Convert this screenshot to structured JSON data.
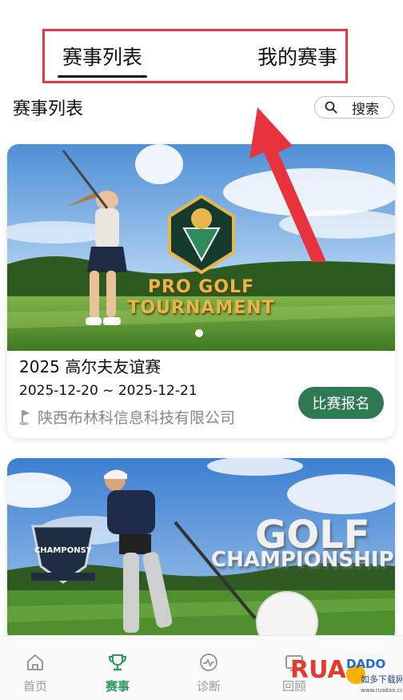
{
  "tabs": [
    {
      "label": "赛事列表",
      "active": true
    },
    {
      "label": "我的赛事",
      "active": false
    }
  ],
  "section": {
    "title": "赛事列表",
    "search_label": "搜索"
  },
  "events": [
    {
      "banner_line1": "PRO GOLF",
      "banner_line2": "TOURNAMENT",
      "name": "2025 高尔夫友谊赛",
      "date": "2025-12-20 ~ 2025-12-21",
      "organizer": "陕西布林科信息科技有限公司",
      "signup_label": "比赛报名"
    },
    {
      "banner_line1": "GOLF",
      "banner_line2": "CHAMPIONSHIP",
      "banner_badge": "CHAMPONSY"
    }
  ],
  "nav": [
    {
      "label": "首页",
      "icon": "home-icon",
      "active": false
    },
    {
      "label": "赛事",
      "icon": "trophy-icon",
      "active": true
    },
    {
      "label": "诊断",
      "icon": "diagnosis-icon",
      "active": false
    },
    {
      "label": "回顾",
      "icon": "replay-icon",
      "active": false
    }
  ],
  "watermark": {
    "text": "RUANDADO",
    "sub": "如多下载网",
    "url": "www.ruadao.com"
  },
  "colors": {
    "accent_green": "#2f7a55",
    "highlight_red": "#e03a44"
  }
}
